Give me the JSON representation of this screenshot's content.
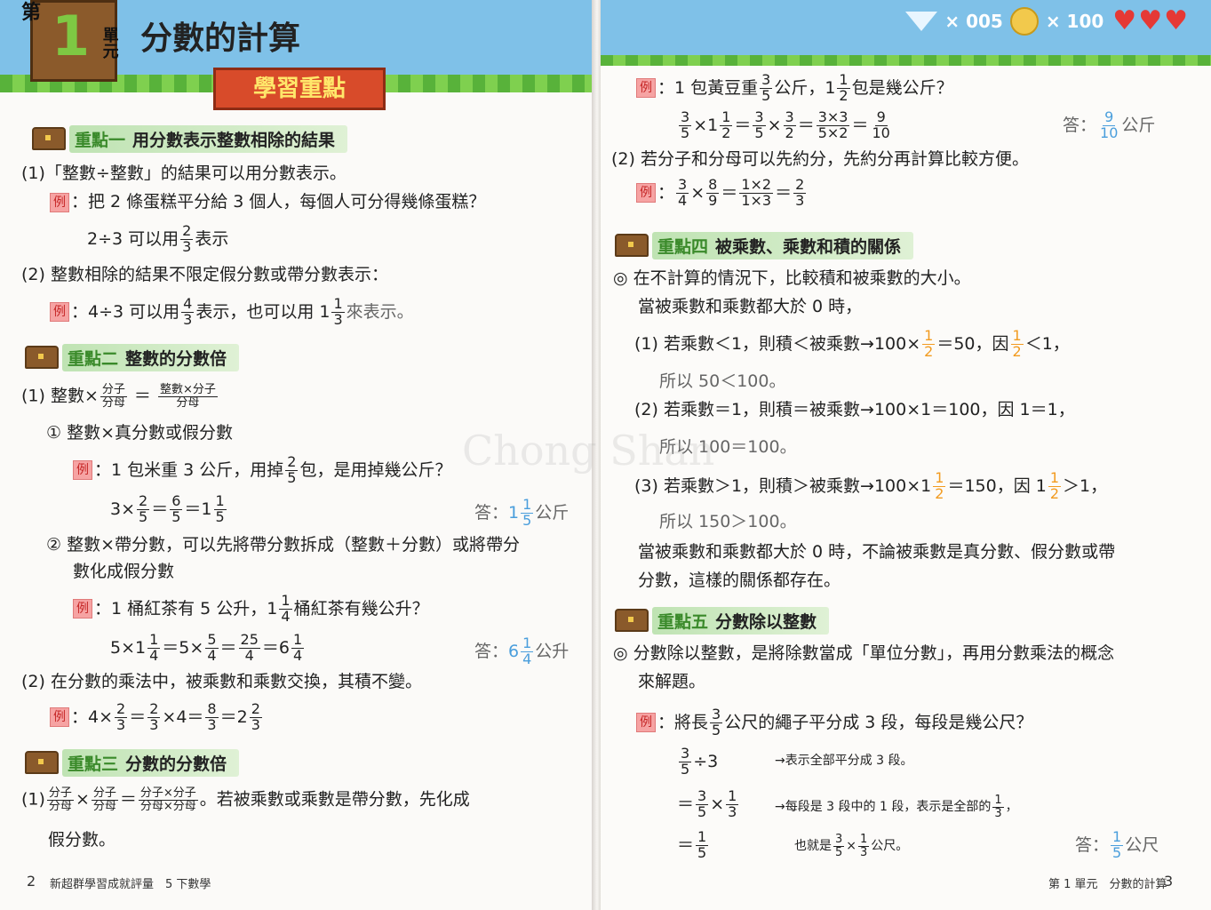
{
  "header": {
    "unit_prefix": "第",
    "unit_number": "1",
    "unit_suffix": "單元",
    "title": "分數的計算",
    "banner": "學習重點",
    "gem_count": "× 005",
    "coin_count": "× 100"
  },
  "left": {
    "k1": {
      "tag": "重點一",
      "title": "用分數表示整數相除的結果"
    },
    "k1_p1": "(1)「整數÷整數」的結果可以用分數表示。",
    "k1_ex1": "：把 2 條蛋糕平分給 3 個人，每個人可分得幾條蛋糕？",
    "k1_ex1_a": "2÷3 可以用",
    "k1_ex1_b": "表示",
    "k1_p2": "(2) 整數相除的結果不限定假分數或帶分數表示：",
    "k1_ex2_a": "：4÷3 可以用",
    "k1_ex2_b": "表示，也可以用 1",
    "k1_ex2_c": "來表示。",
    "k2": {
      "tag": "重點二",
      "title": "整數的分數倍"
    },
    "k2_p1": "(1) 整數×",
    "k2_sub1": "① 整數×真分數或假分數",
    "k2_ex1": "：1 包米重 3 公斤，用掉",
    "k2_ex1_b": "包，是用掉幾公斤？",
    "k2_calc1": "3×",
    "ans_label": "答：",
    "kg": "公斤",
    "liter": "公升",
    "k2_sub2a": "② 整數×帶分數，可以先將帶分數拆成（整數＋分數）或將帶分",
    "k2_sub2b": "數化成假分數",
    "k2_ex2": "：1 桶紅茶有 5 公升，1",
    "k2_ex2_b": "桶紅茶有幾公升？",
    "k2_p2": "(2) 在分數的乘法中，被乘數和乘數交換，其積不變。",
    "k3": {
      "tag": "重點三",
      "title": "分數的分數倍"
    },
    "k3_p1": "。若被乘數或乘數是帶分數，先化成",
    "k3_p1b": "假分數。",
    "words": {
      "num": "分子",
      "den": "分母",
      "int_x_num": "整數×分子",
      "num_x_num": "分子×分子",
      "den_x_den": "分母×分母"
    },
    "footer_page": "2",
    "footer_text": "新超群學習成就評量　5 下數學"
  },
  "right": {
    "ex1": "：1 包黃豆重",
    "ex1_b": "公斤，1",
    "ex1_c": "包是幾公斤？",
    "p2": "(2) 若分子和分母可以先約分，先約分再計算比較方便。",
    "k4": {
      "tag": "重點四",
      "title": "被乘數、乘數和積的關係"
    },
    "k4_p1": "◎ 在不計算的情況下，比較積和被乘數的大小。",
    "k4_p2": "當被乘數和乘數都大於 0 時，",
    "k4_c1": "(1) 若乘數＜1，則積＜被乘數→100×",
    "k4_c1b": "＝50，因",
    "k4_c1c": "＜1，",
    "k4_c1d": "所以 50＜100。",
    "k4_c2": "(2) 若乘數＝1，則積＝被乘數→100×1＝100，因 1＝1，",
    "k4_c2d": "所以 100＝100。",
    "k4_c3": "(3) 若乘數＞1，則積＞被乘數→100×1",
    "k4_c3b": "＝150，因 1",
    "k4_c3c": "＞1，",
    "k4_c3d": "所以 150＞100。",
    "k4_p3": "當被乘數和乘數都大於 0 時，不論被乘數是真分數、假分數或帶",
    "k4_p3b": "分數，這樣的關係都存在。",
    "k5": {
      "tag": "重點五",
      "title": "分數除以整數"
    },
    "k5_p1": "◎ 分數除以整數，是將除數當成「單位分數」，再用分數乘法的概念",
    "k5_p1b": "來解題。",
    "k5_ex": "：將長",
    "k5_ex_b": "公尺的繩子平分成 3 段，每段是幾公尺？",
    "k5_n1": "→表示全部平分成 3 段。",
    "k5_n2": "→每段是 3 段中的 1 段，表示是全部的",
    "k5_n3": "也就是",
    "k5_n3b": "公尺。",
    "meter": "公尺",
    "footer_text": "第 1 單元　分數的計算",
    "footer_page": "3"
  },
  "example_mark": "例",
  "watermark": "Chong Shan",
  "colors": {
    "sky": "#7fc1e8",
    "grass": "#58b23a",
    "answer_blue": "#4a9edc",
    "orange": "#f29b20",
    "pink": "#e86a8a",
    "example_red": "#c62828"
  }
}
